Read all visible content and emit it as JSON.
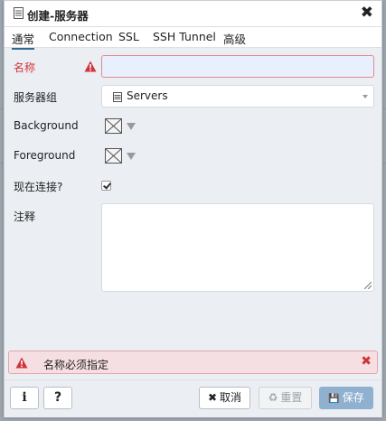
{
  "dialog": {
    "title": "创建-服务器",
    "title_icon": "server-icon",
    "close_label": "✖"
  },
  "tabs": [
    {
      "label": "通常",
      "active": true
    },
    {
      "label": "Connection",
      "active": false
    },
    {
      "label": "SSL",
      "active": false
    },
    {
      "label": "SSH Tunnel",
      "active": false
    },
    {
      "label": "高级",
      "active": false
    }
  ],
  "form": {
    "name_label": "名称",
    "name_value": "",
    "server_group_label": "服务器组",
    "server_group_value": "Servers",
    "background_label": "Background",
    "foreground_label": "Foreground",
    "connect_now_label": "现在连接?",
    "connect_now_checked": true,
    "comments_label": "注释",
    "comments_value": ""
  },
  "error": {
    "message": "名称必须指定",
    "close_label": "✖"
  },
  "footer": {
    "info_label": "i",
    "help_label": "?",
    "cancel_icon": "✖",
    "cancel_label": "取消",
    "reset_icon": "♻",
    "reset_label": "重置",
    "save_icon": "💾",
    "save_label": "保存"
  },
  "colors": {
    "error": "#d0343a",
    "tab_accent": "#326690",
    "save_button": "#8fb0cf"
  }
}
